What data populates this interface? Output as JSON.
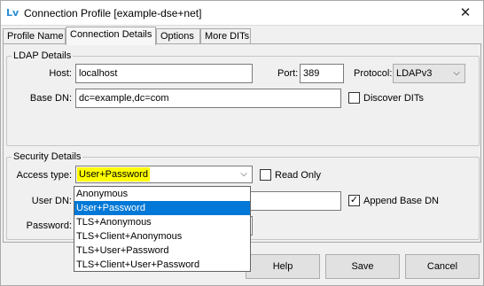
{
  "window": {
    "title": "Connection Profile [example-dse+net]",
    "app_icon_glyph": "Lv",
    "close_glyph": "✕"
  },
  "tabs": [
    {
      "label": "Profile Name"
    },
    {
      "label": "Connection Details",
      "active": true
    },
    {
      "label": "Options"
    },
    {
      "label": "More DITs"
    }
  ],
  "ldap": {
    "legend": "LDAP Details",
    "host_label": "Host:",
    "host_value": "localhost",
    "port_label": "Port:",
    "port_value": "389",
    "protocol_label": "Protocol:",
    "protocol_value": "LDAPv3",
    "base_dn_label": "Base DN:",
    "base_dn_value": "dc=example,dc=com",
    "discover_dits_label": "Discover DITs",
    "discover_dits_checked": false
  },
  "security": {
    "legend": "Security Details",
    "access_type_label": "Access type:",
    "access_type_value": "User+Password",
    "read_only_label": "Read Only",
    "read_only_checked": false,
    "user_dn_label": "User DN:",
    "append_base_dn_label": "Append Base DN",
    "append_base_dn_checked": true,
    "password_label": "Password:",
    "access_type_options": [
      "Anonymous",
      "User+Password",
      "TLS+Anonymous",
      "TLS+Client+Anonymous",
      "TLS+User+Password",
      "TLS+Client+User+Password"
    ],
    "selected_option_index": 1,
    "highlight_color": "#ffff00",
    "selection_color": "#0078d7"
  },
  "buttons": {
    "help": "Help",
    "save": "Save",
    "cancel": "Cancel"
  },
  "icons": {
    "dropdown_arrow": "⌵",
    "checkmark": "✓"
  }
}
